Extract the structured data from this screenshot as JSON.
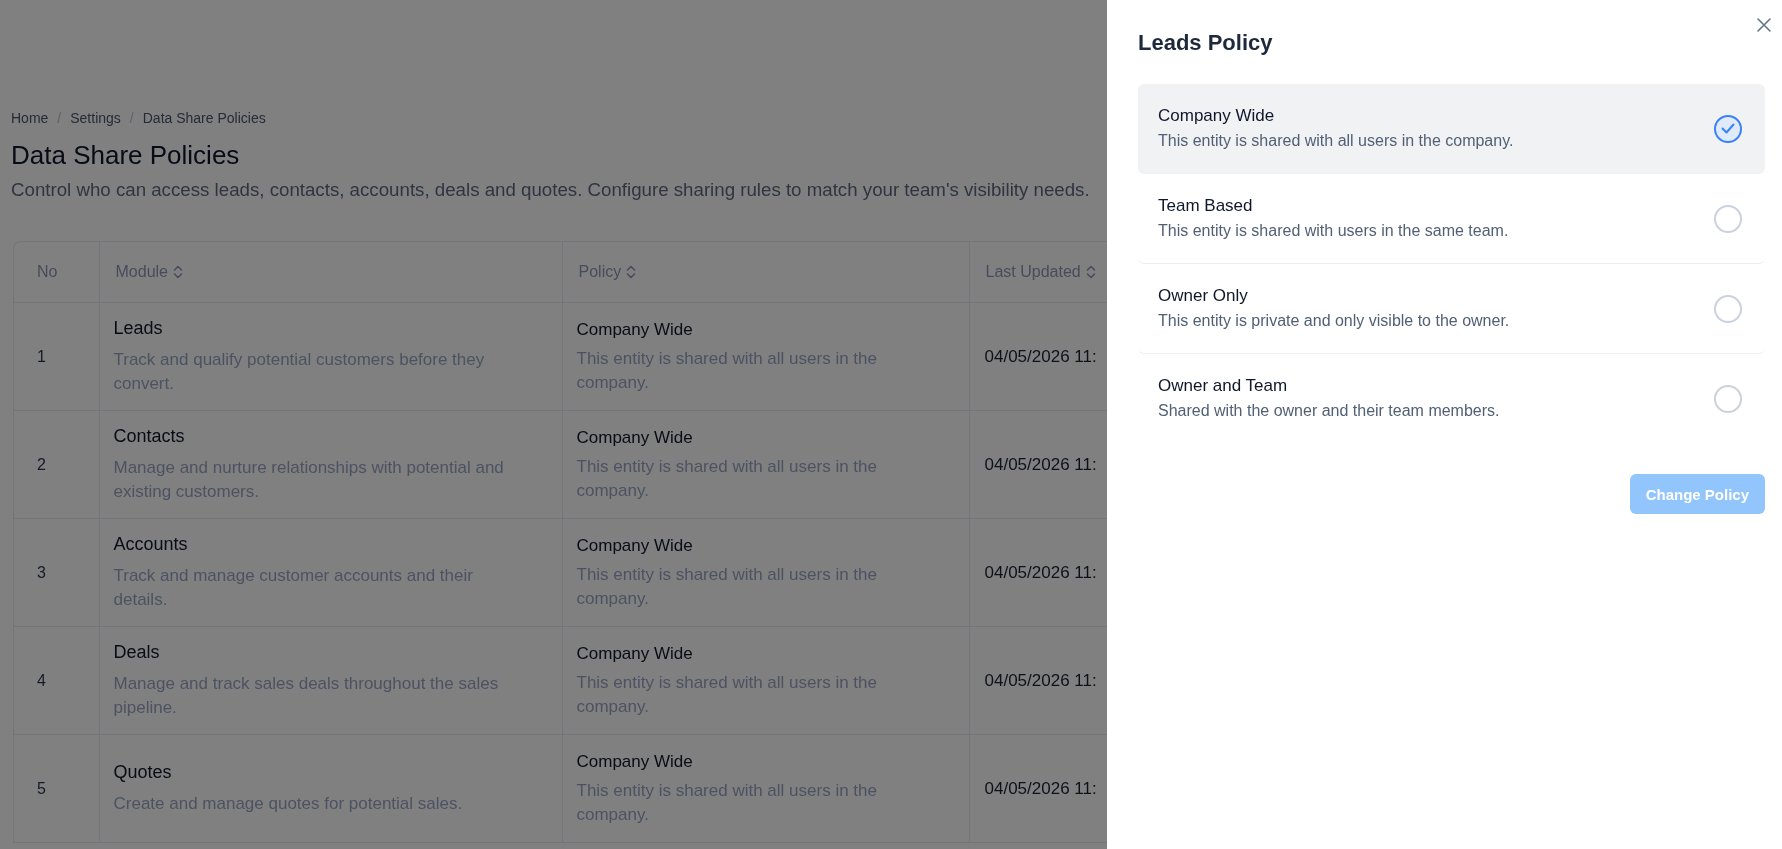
{
  "breadcrumb": [
    {
      "label": "Home",
      "separator": "/"
    },
    {
      "label": "Settings",
      "separator": "/"
    },
    {
      "label": "Data Share Policies"
    }
  ],
  "page": {
    "title": "Data Share Policies",
    "description": "Control who can access leads, contacts, accounts, deals and quotes. Configure sharing rules to match your team's visibility needs."
  },
  "table": {
    "columns": [
      {
        "label": "No",
        "sortable": false
      },
      {
        "label": "Module",
        "sortable": true
      },
      {
        "label": "Policy",
        "sortable": true
      },
      {
        "label": "Last Updated",
        "sortable": true
      }
    ],
    "rows": [
      {
        "no": "1",
        "module": "Leads",
        "module_description": "Track and qualify potential customers before they convert.",
        "policy": "Company Wide",
        "policy_description": "This entity is shared with all users in the company.",
        "last_updated": "04/05/2026 11:"
      },
      {
        "no": "2",
        "module": "Contacts",
        "module_description": "Manage and nurture relationships with potential and existing customers.",
        "policy": "Company Wide",
        "policy_description": "This entity is shared with all users in the company.",
        "last_updated": "04/05/2026 11:"
      },
      {
        "no": "3",
        "module": "Accounts",
        "module_description": "Track and manage customer accounts and their details.",
        "policy": "Company Wide",
        "policy_description": "This entity is shared with all users in the company.",
        "last_updated": "04/05/2026 11:"
      },
      {
        "no": "4",
        "module": "Deals",
        "module_description": "Manage and track sales deals throughout the sales pipeline.",
        "policy": "Company Wide",
        "policy_description": "This entity is shared with all users in the company.",
        "last_updated": "04/05/2026 11:"
      },
      {
        "no": "5",
        "module": "Quotes",
        "module_description": "Create and manage quotes for potential sales.",
        "policy": "Company Wide",
        "policy_description": "This entity is shared with all users in the company.",
        "last_updated": "04/05/2026 11:"
      }
    ]
  },
  "drawer": {
    "title": "Leads Policy",
    "options": [
      {
        "title": "Company Wide",
        "description": "This entity is shared with all users in the company.",
        "selected": true
      },
      {
        "title": "Team Based",
        "description": "This entity is shared with users in the same team.",
        "selected": false
      },
      {
        "title": "Owner Only",
        "description": "This entity is private and only visible to the owner.",
        "selected": false
      },
      {
        "title": "Owner and Team",
        "description": "Shared with the owner and their team members.",
        "selected": false
      }
    ],
    "button": {
      "label": "Change Policy",
      "disabled": true
    }
  }
}
